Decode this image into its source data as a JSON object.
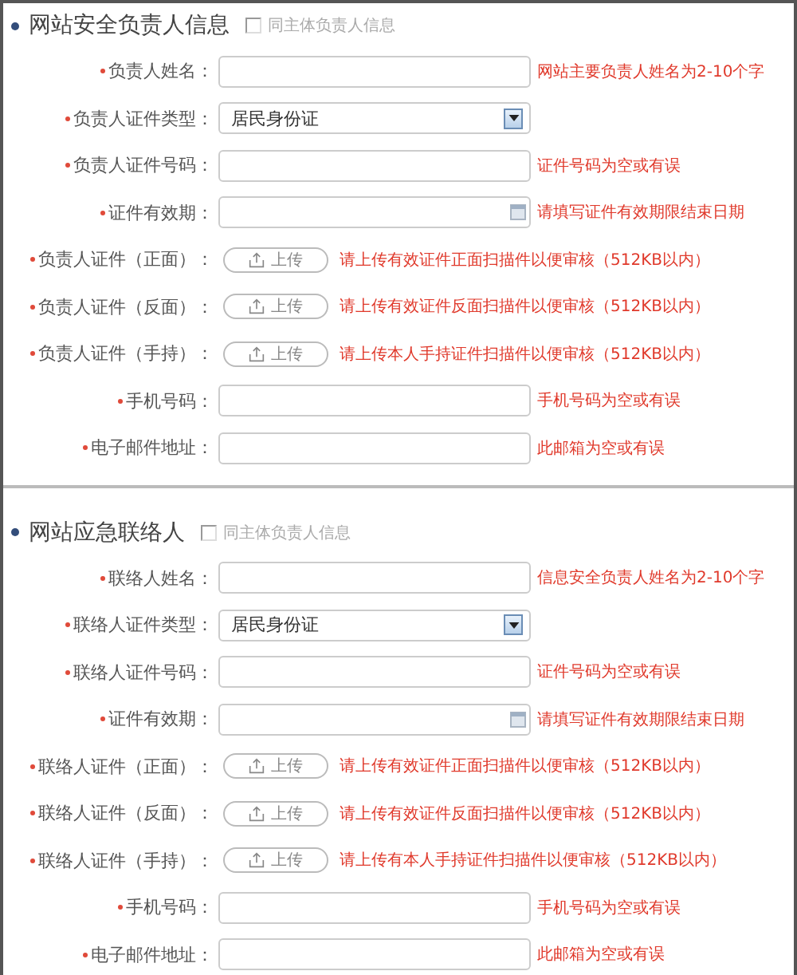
{
  "sections": [
    {
      "title": "网站安全负责人信息",
      "same_as": {
        "label": "同主体负责人信息",
        "checked": false
      },
      "fields": [
        {
          "kind": "text",
          "required": true,
          "label": "负责人姓名：",
          "hint": "网站主要负责人姓名为2-10个字"
        },
        {
          "kind": "select",
          "required": true,
          "label": "负责人证件类型：",
          "value": "居民身份证"
        },
        {
          "kind": "text",
          "required": true,
          "label": "负责人证件号码：",
          "hint": "证件号码为空或有误"
        },
        {
          "kind": "date",
          "required": true,
          "label": "证件有效期：",
          "hint": "请填写证件有效期限结束日期"
        },
        {
          "kind": "upload",
          "required": true,
          "label": "负责人证件（正面）：",
          "button": "上传",
          "hint": "请上传有效证件正面扫描件以便审核（512KB以内）"
        },
        {
          "kind": "upload",
          "required": true,
          "label": "负责人证件（反面）：",
          "button": "上传",
          "hint": "请上传有效证件反面扫描件以便审核（512KB以内）"
        },
        {
          "kind": "upload",
          "required": true,
          "label": "负责人证件（手持）：",
          "button": "上传",
          "hint": "请上传本人手持证件扫描件以便审核（512KB以内）"
        },
        {
          "kind": "text",
          "required": true,
          "label": "手机号码：",
          "hint": "手机号码为空或有误"
        },
        {
          "kind": "text",
          "required": true,
          "label": "电子邮件地址：",
          "hint": "此邮箱为空或有误"
        }
      ]
    },
    {
      "title": "网站应急联络人",
      "same_as": {
        "label": "同主体负责人信息",
        "checked": false
      },
      "fields": [
        {
          "kind": "text",
          "required": true,
          "label": "联络人姓名：",
          "hint": "信息安全负责人姓名为2-10个字"
        },
        {
          "kind": "select",
          "required": true,
          "label": "联络人证件类型：",
          "value": "居民身份证"
        },
        {
          "kind": "text",
          "required": true,
          "label": "联络人证件号码：",
          "hint": "证件号码为空或有误"
        },
        {
          "kind": "date",
          "required": true,
          "label": "证件有效期：",
          "hint": "请填写证件有效期限结束日期"
        },
        {
          "kind": "upload",
          "required": true,
          "label": "联络人证件（正面）：",
          "button": "上传",
          "hint": "请上传有效证件正面扫描件以便审核（512KB以内）"
        },
        {
          "kind": "upload",
          "required": true,
          "label": "联络人证件（反面）：",
          "button": "上传",
          "hint": "请上传有效证件反面扫描件以便审核（512KB以内）"
        },
        {
          "kind": "upload",
          "required": true,
          "label": "联络人证件（手持）：",
          "button": "上传",
          "hint": "请上传有本人手持证件扫描件以便审核（512KB以内）"
        },
        {
          "kind": "text",
          "required": true,
          "label": "手机号码：",
          "hint": "手机号码为空或有误"
        },
        {
          "kind": "text",
          "required": true,
          "label": "电子邮件地址：",
          "hint": "此邮箱为空或有误"
        }
      ]
    }
  ]
}
